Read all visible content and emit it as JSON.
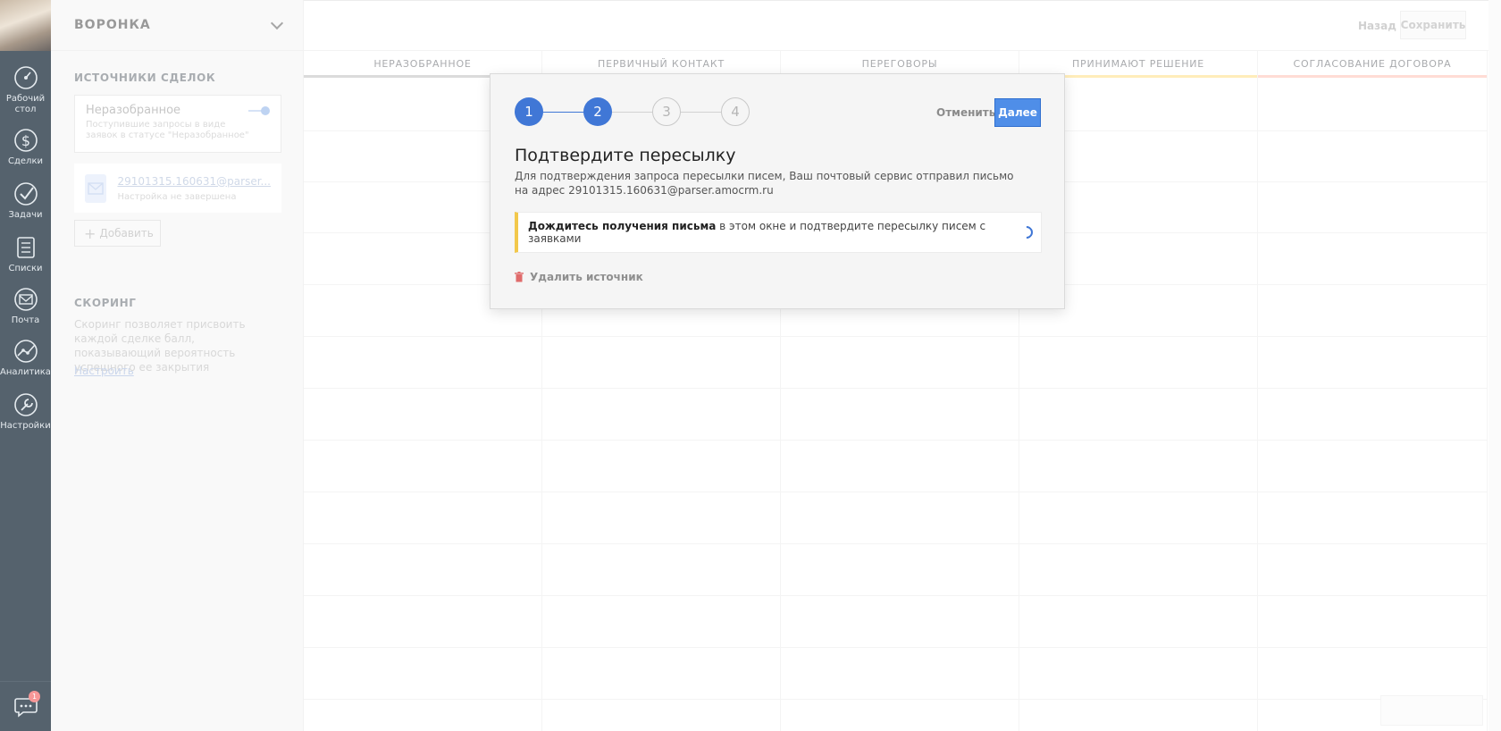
{
  "nav": {
    "items": [
      {
        "label": "Рабочий стол",
        "icon": "dashboard-icon"
      },
      {
        "label": "Сделки",
        "icon": "dollar-icon"
      },
      {
        "label": "Задачи",
        "icon": "check-icon"
      },
      {
        "label": "Списки",
        "icon": "list-icon"
      },
      {
        "label": "Почта",
        "icon": "mail-icon"
      },
      {
        "label": "Аналитика",
        "icon": "analytics-icon"
      },
      {
        "label": "Настройки",
        "icon": "wrench-icon"
      }
    ],
    "chat_badge": "1"
  },
  "panel": {
    "title": "ВОРОНКА",
    "sources_title": "ИСТОЧНИКИ СДЕЛОК",
    "source": {
      "name": "Неразобранное",
      "description": "Поступившие запросы в виде заявок в статусе \"Неразобранное\""
    },
    "mail": {
      "address": "29101315.160631@parser...",
      "status": "Настройка не завершена"
    },
    "add_label": "Добавить",
    "scoring_title": "СКОРИНГ",
    "scoring_text": "Скоринг позволяет присвоить каждой сделке балл, показывающий вероятность успешного ее закрытия",
    "scoring_link": "Настроить"
  },
  "topbar": {
    "back_label": "Назад",
    "save_label": "Сохранить"
  },
  "board": {
    "columns": [
      {
        "label": "НЕРАЗОБРАННОЕ",
        "color": "#cfcfcf"
      },
      {
        "label": "ПЕРВИЧНЫЙ КОНТАКТ",
        "color": "#f3f3f3"
      },
      {
        "label": "ПЕРЕГОВОРЫ",
        "color": "#f3f3f3"
      },
      {
        "label": "ПРИНИМАЮТ РЕШЕНИЕ",
        "color": "#ffe7a3"
      },
      {
        "label": "СОГЛАСОВАНИЕ ДОГОВОРА",
        "color": "#ffd1c7"
      }
    ]
  },
  "modal": {
    "steps": [
      "1",
      "2",
      "3",
      "4"
    ],
    "current_step": 2,
    "cancel_label": "Отменить",
    "next_label": "Далее",
    "title": "Подтвердите пересылку",
    "description": "Для подтверждения запроса пересылки писем, Ваш почтовый сервис отправил письмо на адрес 29101315.160631@parser.amocrm.ru",
    "notice_bold": "Дождитесь получения письма",
    "notice_rest": " в этом окне и подтвердите пересылку писем с заявками",
    "delete_label": "Удалить источник",
    "accent": "#4077d6"
  }
}
